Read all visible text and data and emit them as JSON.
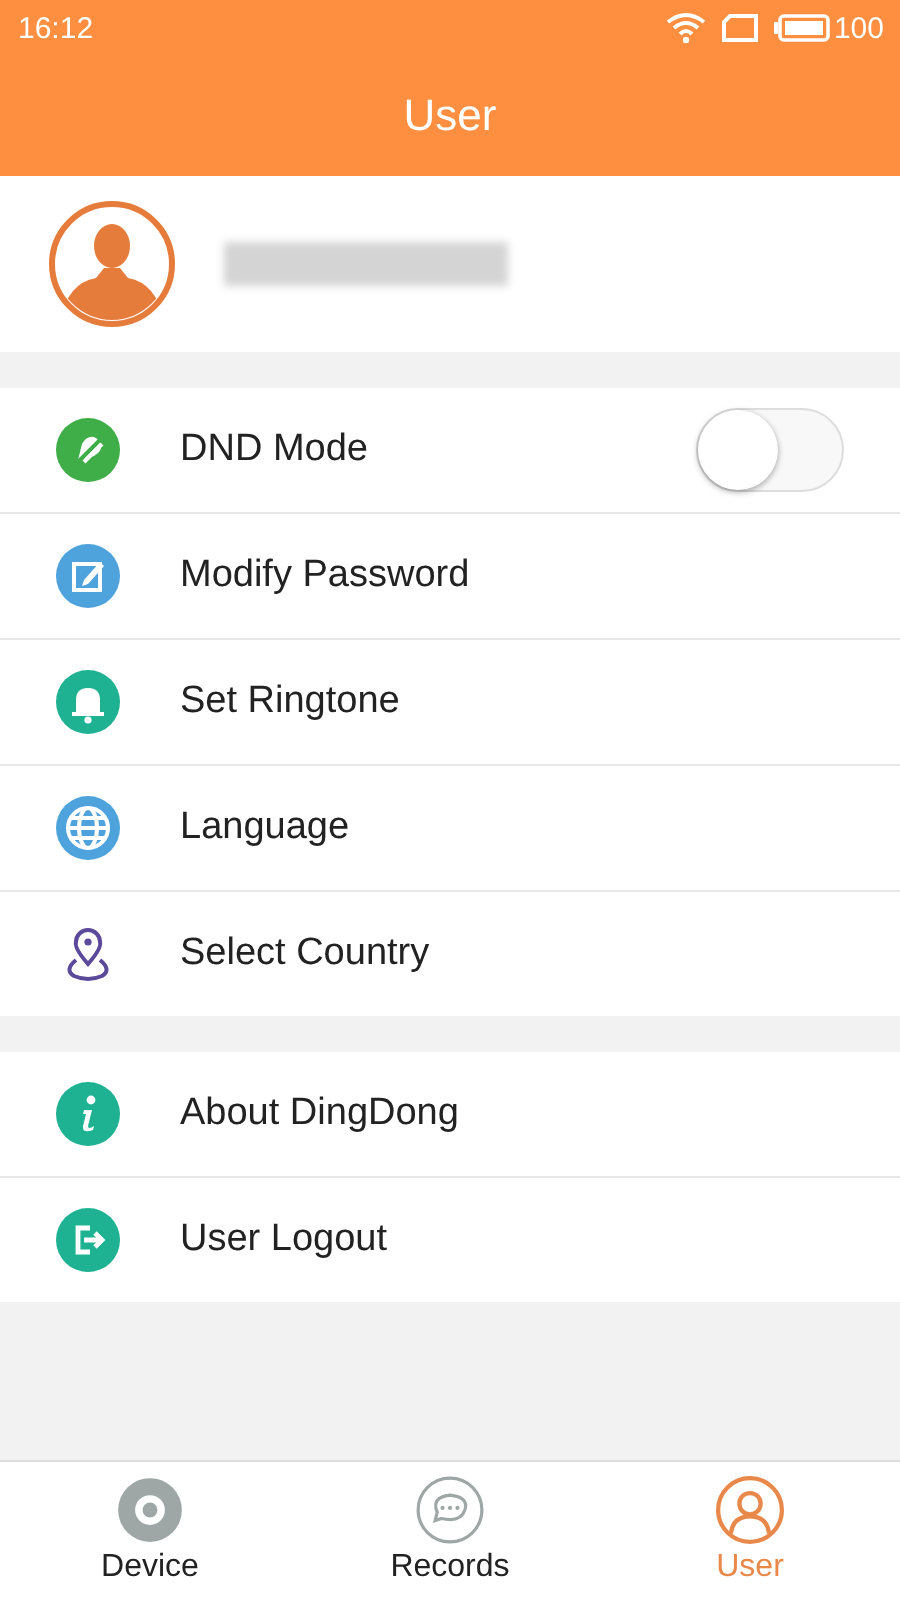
{
  "status_bar": {
    "time": "16:12",
    "battery": "100"
  },
  "header": {
    "title": "User"
  },
  "sections": [
    {
      "items": [
        {
          "kind": "toggle",
          "label": "DND Mode",
          "on": false
        },
        {
          "kind": "link",
          "label": "Modify Password"
        },
        {
          "kind": "link",
          "label": "Set Ringtone"
        },
        {
          "kind": "link",
          "label": "Language"
        },
        {
          "kind": "link",
          "label": "Select Country"
        }
      ]
    },
    {
      "items": [
        {
          "kind": "link",
          "label": "About DingDong"
        },
        {
          "kind": "link",
          "label": "User Logout"
        }
      ]
    }
  ],
  "tabs": [
    {
      "label": "Device",
      "selected": false
    },
    {
      "label": "Records",
      "selected": false
    },
    {
      "label": "User",
      "selected": true
    }
  ]
}
